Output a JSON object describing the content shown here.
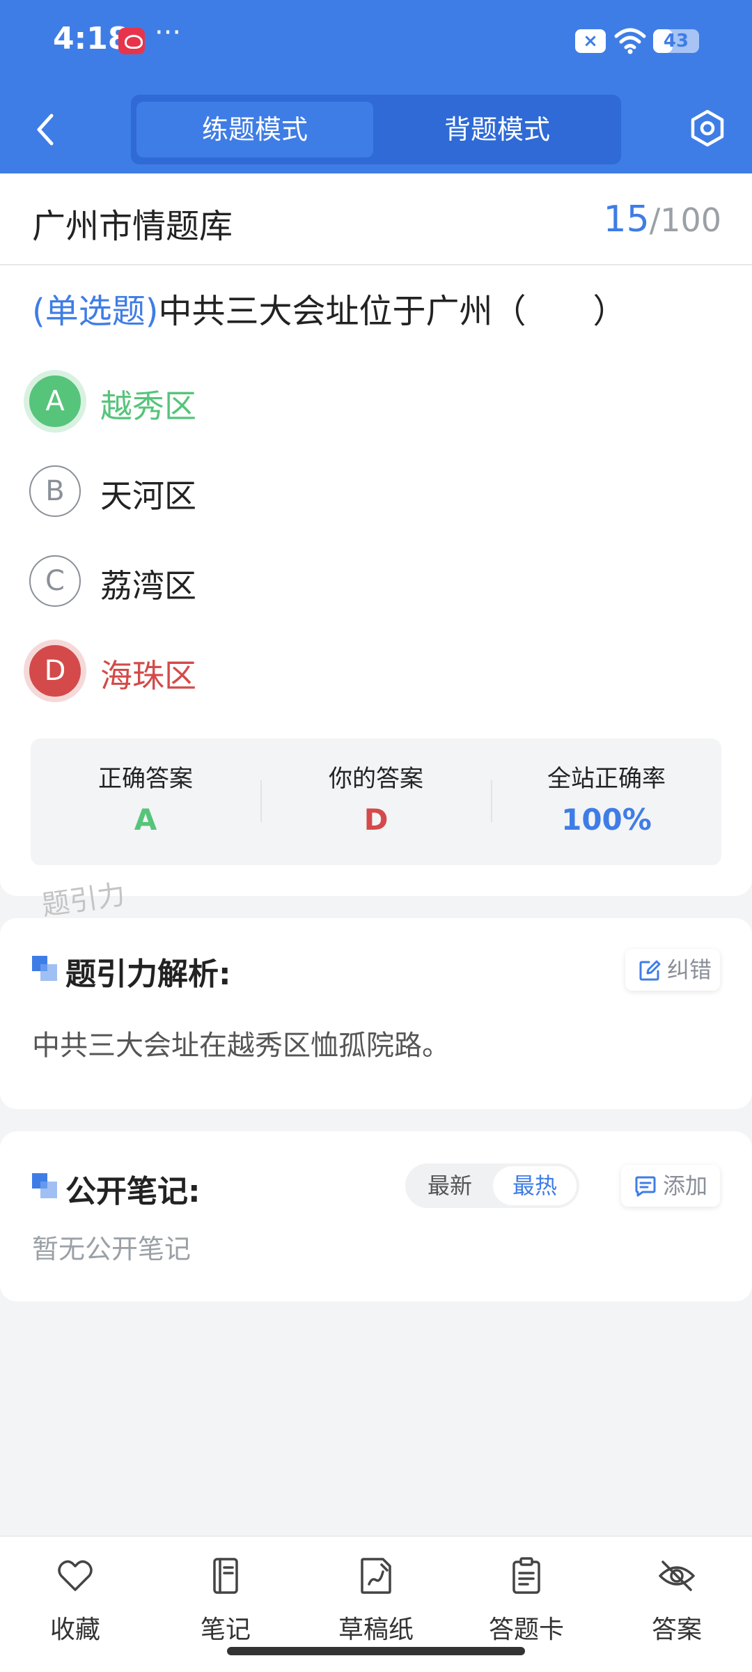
{
  "status_bar": {
    "time": "4:18",
    "overflow": "···",
    "battery": "43",
    "battery_level": 0.43,
    "x_badge": "×"
  },
  "header": {
    "tabs": [
      {
        "label": "练题模式",
        "active": true
      },
      {
        "label": "背题模式",
        "active": false
      }
    ]
  },
  "title_bar": {
    "bank_name": "广州市情题库",
    "current": "15",
    "total_text": "/100"
  },
  "question": {
    "type_label": "(单选题)",
    "text": "中共三大会址位于广州（　　）",
    "options": [
      {
        "letter": "A",
        "text": "越秀区",
        "state": "correct"
      },
      {
        "letter": "B",
        "text": "天河区",
        "state": "normal"
      },
      {
        "letter": "C",
        "text": "荔湾区",
        "state": "normal"
      },
      {
        "letter": "D",
        "text": "海珠区",
        "state": "wrong"
      }
    ]
  },
  "answer_summary": {
    "correct_label": "正确答案",
    "correct_value": "A",
    "yours_label": "你的答案",
    "yours_value": "D",
    "rate_label": "全站正确率",
    "rate_value": "100%"
  },
  "watermark": "题引力",
  "analysis": {
    "title": "题引力解析:",
    "correct_btn": "纠错",
    "text": "中共三大会址在越秀区恤孤院路。"
  },
  "notes": {
    "title": "公开笔记:",
    "sort_latest": "最新",
    "sort_hot": "最热",
    "add_btn": "添加",
    "empty": "暂无公开笔记"
  },
  "bottom_nav": [
    {
      "label": "收藏",
      "icon": "heart-icon"
    },
    {
      "label": "笔记",
      "icon": "notebook-icon"
    },
    {
      "label": "草稿纸",
      "icon": "draft-paper-icon"
    },
    {
      "label": "答题卡",
      "icon": "answer-card-icon"
    },
    {
      "label": "答案",
      "icon": "eye-off-icon"
    }
  ],
  "colors": {
    "primary": "#3f7de6",
    "correct": "#56c47a",
    "wrong": "#d44a4a"
  }
}
